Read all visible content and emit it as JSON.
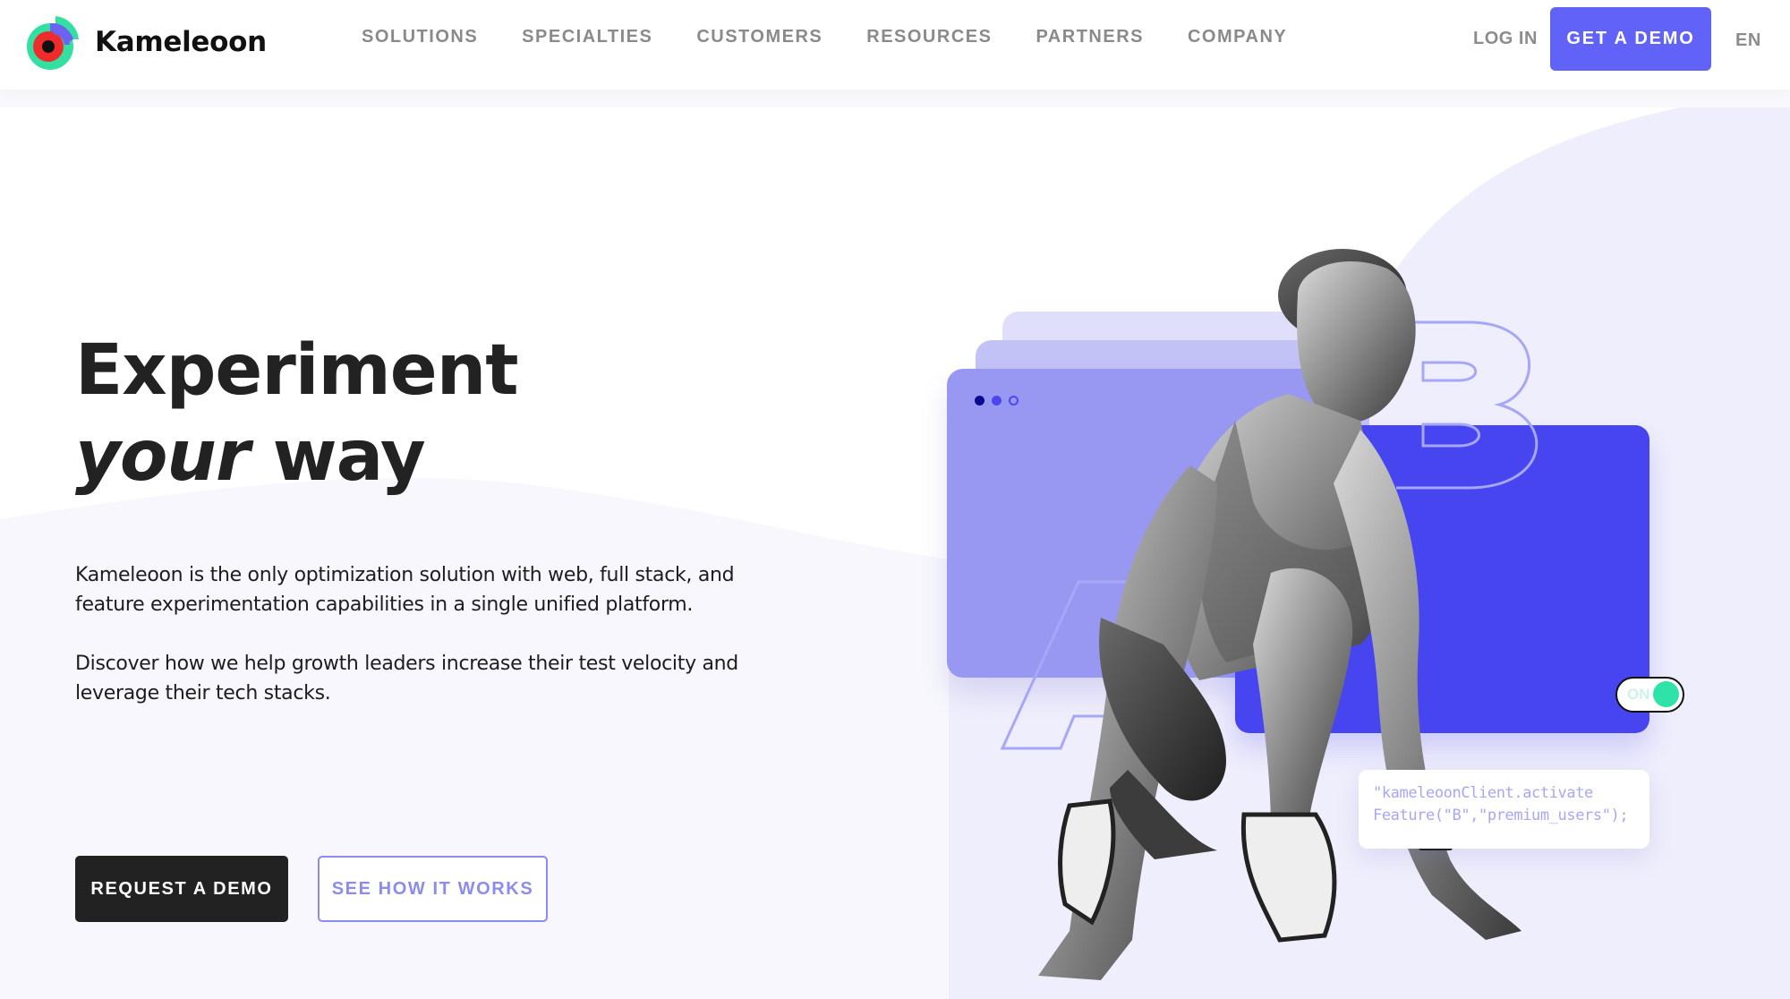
{
  "header": {
    "brand": "Kameleoon",
    "nav": [
      {
        "label": "SOLUTIONS"
      },
      {
        "label": "SPECIALTIES"
      },
      {
        "label": "CUSTOMERS"
      },
      {
        "label": "RESOURCES"
      },
      {
        "label": "PARTNERS"
      },
      {
        "label": "COMPANY"
      }
    ],
    "login_label": "LOG IN",
    "demo_label": "GET A DEMO",
    "language": "EN"
  },
  "hero": {
    "title_line1": "Experiment",
    "title_line2_italic": "your",
    "title_line2_rest": " way",
    "paragraphs": [
      "Kameleoon is the only optimization solution with web, full stack, and feature experimentation capabilities in a single unified platform.",
      "Discover how we help growth leaders increase their test velocity and leverage their tech stacks."
    ],
    "primary_cta": "REQUEST A DEMO",
    "secondary_cta": "SEE HOW IT WORKS"
  },
  "illustration": {
    "toggle_label": "ON",
    "toggle_state": "on",
    "code_lines": [
      "\"kameleoonClient.activate",
      "Feature(\"B\",\"premium_users\");"
    ],
    "letters": [
      "A",
      "B"
    ]
  },
  "colors": {
    "brand_accent": "#6163f8",
    "dark": "#222222",
    "secondary_text": "#8b8cf2",
    "card_blue": "#4745f0",
    "card_lilac": "#9898f3",
    "toggle_green": "#2ee2a8"
  }
}
